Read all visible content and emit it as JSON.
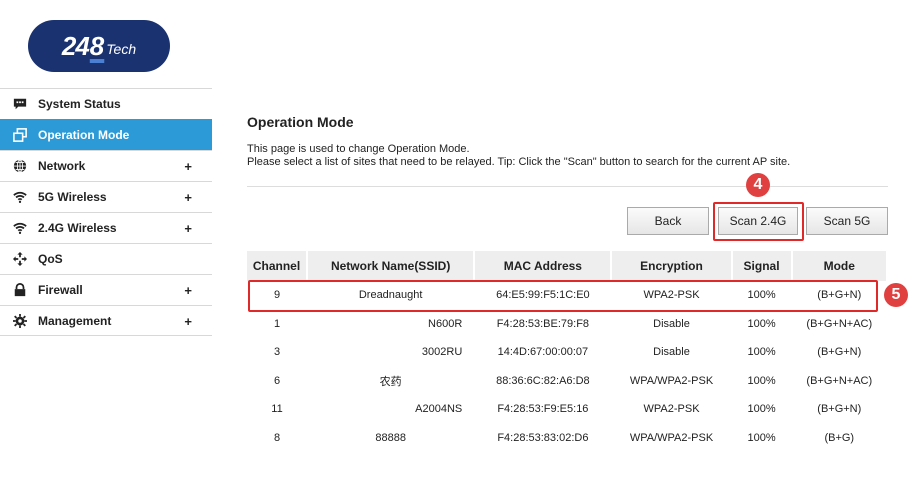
{
  "logo": {
    "num": "24",
    "eight": "8",
    "tech": "Tech"
  },
  "sidebar": {
    "items": [
      {
        "label": "System Status",
        "icon": "chat-icon",
        "expandable": false,
        "active": false
      },
      {
        "label": "Operation Mode",
        "icon": "windows-icon",
        "expandable": false,
        "active": true
      },
      {
        "label": "Network",
        "icon": "globe-icon",
        "expandable": true,
        "active": false
      },
      {
        "label": "5G Wireless",
        "icon": "wifi-icon",
        "expandable": true,
        "active": false
      },
      {
        "label": "2.4G Wireless",
        "icon": "wifi-icon",
        "expandable": true,
        "active": false
      },
      {
        "label": "QoS",
        "icon": "arrows-icon",
        "expandable": false,
        "active": false
      },
      {
        "label": "Firewall",
        "icon": "lock-icon",
        "expandable": true,
        "active": false
      },
      {
        "label": "Management",
        "icon": "gear-icon",
        "expandable": true,
        "active": false
      }
    ],
    "plus": "+"
  },
  "main": {
    "title": "Operation Mode",
    "desc1": "This page is used to change Operation Mode.",
    "desc2": "Please select a list of sites that need to be relayed. Tip: Click the \"Scan\" button to search for the current AP site."
  },
  "buttons": {
    "back": "Back",
    "scan24": "Scan 2.4G",
    "scan5": "Scan 5G"
  },
  "annotations": {
    "step4": "4",
    "step5": "5",
    "color": "#e02a2a"
  },
  "table": {
    "headers": [
      "Channel",
      "Network Name(SSID)",
      "MAC Address",
      "Encryption",
      "Signal",
      "Mode"
    ],
    "rows": [
      {
        "channel": "9",
        "ssid": "Dreadnaught",
        "mac": "64:E5:99:F5:1C:E0",
        "enc": "WPA2-PSK",
        "signal": "100%",
        "mode": "(B+G+N)"
      },
      {
        "channel": "1",
        "ssid": "N600R",
        "mac": "F4:28:53:BE:79:F8",
        "enc": "Disable",
        "signal": "100%",
        "mode": "(B+G+N+AC)"
      },
      {
        "channel": "3",
        "ssid": "3002RU",
        "mac": "14:4D:67:00:00:07",
        "enc": "Disable",
        "signal": "100%",
        "mode": "(B+G+N)"
      },
      {
        "channel": "6",
        "ssid": "农药",
        "mac": "88:36:6C:82:A6:D8",
        "enc": "WPA/WPA2-PSK",
        "signal": "100%",
        "mode": "(B+G+N+AC)"
      },
      {
        "channel": "11",
        "ssid": "A2004NS",
        "mac": "F4:28:53:F9:E5:16",
        "enc": "WPA2-PSK",
        "signal": "100%",
        "mode": "(B+G+N)"
      },
      {
        "channel": "8",
        "ssid": "88888",
        "mac": "F4:28:53:83:02:D6",
        "enc": "WPA/WPA2-PSK",
        "signal": "100%",
        "mode": "(B+G)"
      }
    ]
  }
}
